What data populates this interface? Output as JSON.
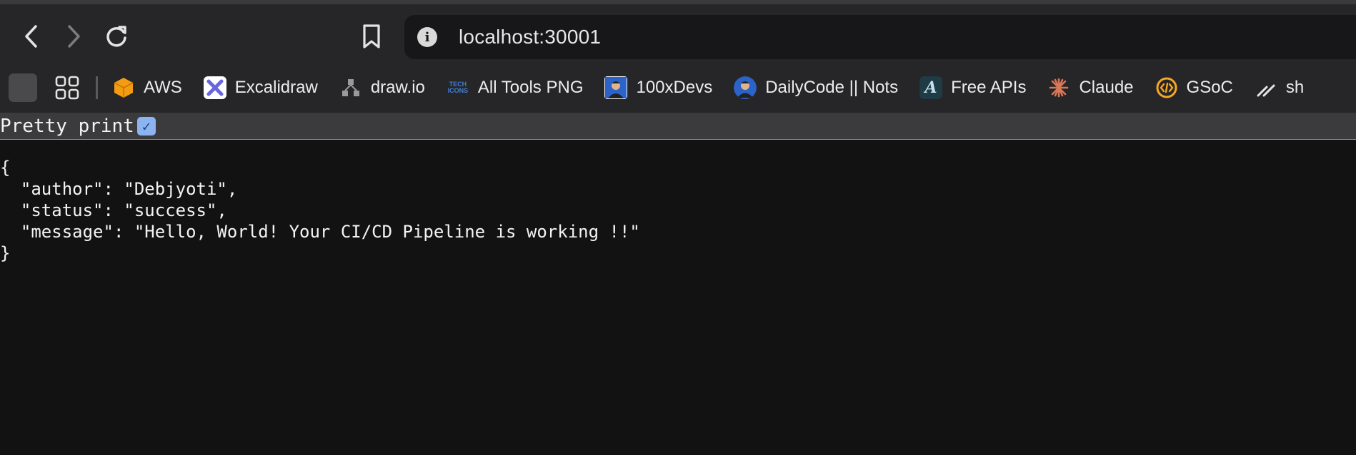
{
  "window": {
    "url": "localhost:30001"
  },
  "bookmarks": [
    {
      "label": "AWS",
      "icon": "aws-cube-icon",
      "color": "#f39c12"
    },
    {
      "label": "Excalidraw",
      "icon": "excalidraw-icon",
      "color": "#6965db"
    },
    {
      "label": "draw.io",
      "icon": "drawio-icon",
      "color": "#9a9a9a"
    },
    {
      "label": "All Tools PNG",
      "icon": "tech-icons-icon",
      "color": "#3f7fd6"
    },
    {
      "label": "100xDevs",
      "icon": "avatar-icon",
      "color": "#2b63c9"
    },
    {
      "label": "DailyCode || Nots",
      "icon": "avatar-icon",
      "color": "#2b63c9"
    },
    {
      "label": "Free APIs",
      "icon": "free-apis-icon",
      "color": "#1f3b45"
    },
    {
      "label": "Claude",
      "icon": "claude-icon",
      "color": "#d97757"
    },
    {
      "label": "GSoC",
      "icon": "gsoc-icon",
      "color": "#f5a623"
    },
    {
      "label": "sh",
      "icon": "slash-icon",
      "color": "#cfcfcf"
    }
  ],
  "viewer": {
    "pretty_print_label": "Pretty print",
    "pretty_print_checked": true,
    "lines": [
      "{",
      "  \"author\": \"Debjyoti\",",
      "  \"status\": \"success\",",
      "  \"message\": \"Hello, World! Your CI/CD Pipeline is working !!\"",
      "}"
    ]
  }
}
